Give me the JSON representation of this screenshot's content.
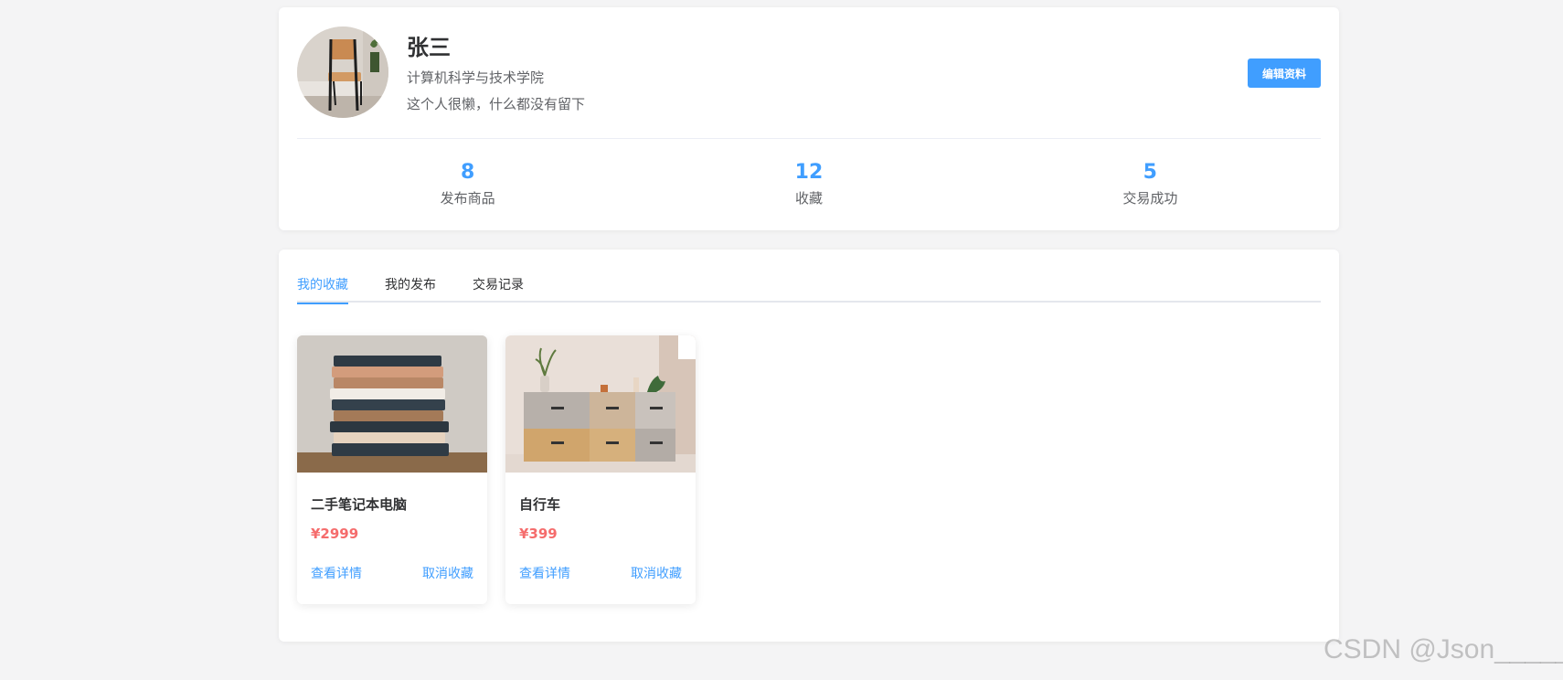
{
  "profile": {
    "name": "张三",
    "college": "计算机科学与技术学院",
    "bio": "这个人很懒，什么都没有留下",
    "edit_label": "编辑资料",
    "avatar_icon": "chair-photo"
  },
  "stats": [
    {
      "value": "8",
      "label": "发布商品"
    },
    {
      "value": "12",
      "label": "收藏"
    },
    {
      "value": "5",
      "label": "交易成功"
    }
  ],
  "tabs": [
    {
      "label": "我的收藏",
      "active": true
    },
    {
      "label": "我的发布",
      "active": false
    },
    {
      "label": "交易记录",
      "active": false
    }
  ],
  "products": [
    {
      "title": "二手笔记本电脑",
      "price": "¥2999",
      "image": "book-stack-photo",
      "detail_label": "查看详情",
      "action_label": "取消收藏"
    },
    {
      "title": "自行车",
      "price": "¥399",
      "image": "storage-boxes-photo",
      "detail_label": "查看详情",
      "action_label": "取消收藏"
    }
  ],
  "watermark": "CSDN @Json_____",
  "colors": {
    "accent": "#409eff",
    "price": "#f56c6c",
    "background": "#f4f4f5"
  }
}
